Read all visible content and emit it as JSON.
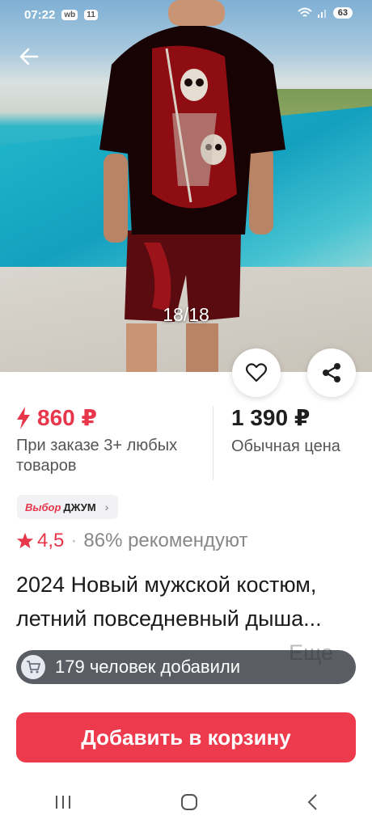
{
  "status_bar": {
    "time": "07:22",
    "icon1": "wb",
    "icon2": "11",
    "battery": "63"
  },
  "gallery": {
    "counter": "18/18"
  },
  "price": {
    "sale": "860 ₽",
    "sale_condition": "При заказе 3+ любых товаров",
    "regular": "1 390 ₽",
    "regular_label": "Обычная цена"
  },
  "badge": {
    "part1": "Выбор",
    "part2": "ДЖУМ"
  },
  "rating": {
    "value": "4,5",
    "recommend": "86% рекомендуют"
  },
  "product": {
    "title": "2024 Новый мужской костюм, летний повседневный дыша...",
    "more": "Еще"
  },
  "toast": {
    "text": "179 человек добавили"
  },
  "actions": {
    "add_to_cart": "Добавить в корзину"
  },
  "colors": {
    "accent": "#ed3a4c",
    "price_red": "#e8374b"
  },
  "icons": [
    "arrow-left-icon",
    "heart-icon",
    "share-icon",
    "lightning-icon",
    "star-icon",
    "chevron-right-icon",
    "cart-icon",
    "recent-apps-icon",
    "home-icon",
    "back-nav-icon"
  ]
}
